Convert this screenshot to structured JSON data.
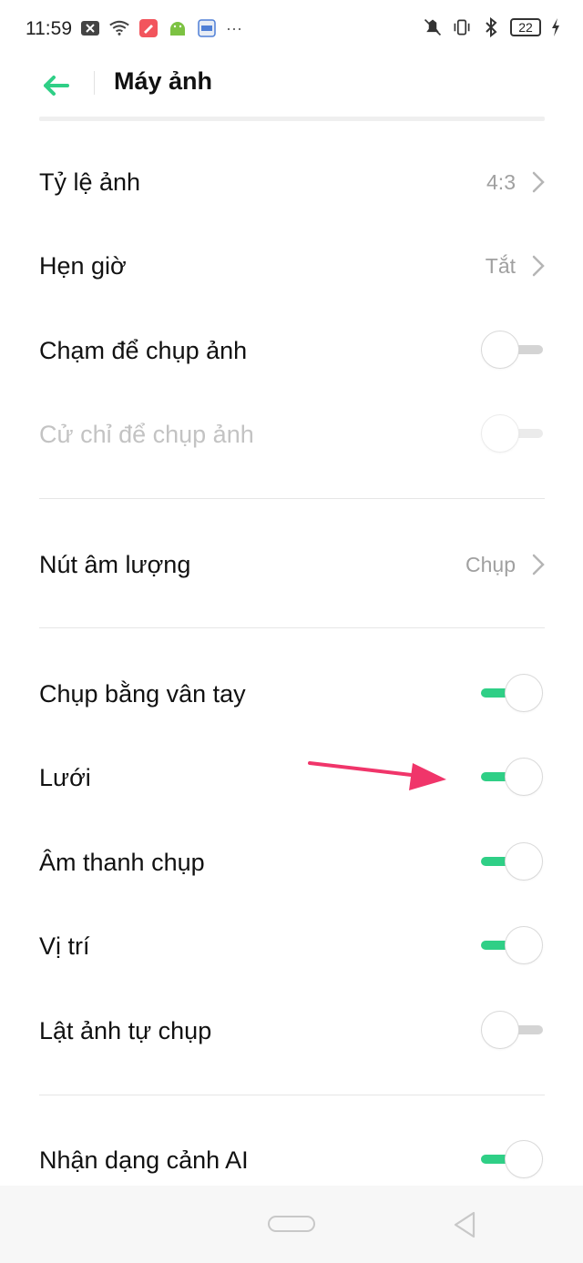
{
  "status_bar": {
    "time": "11:59",
    "more": "···",
    "battery": "22"
  },
  "header": {
    "title": "Máy ảnh"
  },
  "settings": {
    "aspect_ratio": {
      "label": "Tỷ lệ ảnh",
      "value": "4:3"
    },
    "timer": {
      "label": "Hẹn giờ",
      "value": "Tắt"
    },
    "tap_to_capture": {
      "label": "Chạm để chụp ảnh",
      "enabled": false
    },
    "gesture_capture": {
      "label": "Cử chỉ để chụp ảnh",
      "enabled": false,
      "disabled": true
    },
    "volume_button": {
      "label": "Nút âm lượng",
      "value": "Chụp"
    },
    "fingerprint_capture": {
      "label": "Chụp bằng vân tay",
      "enabled": true
    },
    "grid": {
      "label": "Lưới",
      "enabled": true
    },
    "shutter_sound": {
      "label": "Âm thanh chụp",
      "enabled": true
    },
    "location": {
      "label": "Vị trí",
      "enabled": true
    },
    "mirror_selfie": {
      "label": "Lật ảnh tự chụp",
      "enabled": false
    },
    "ai_scene": {
      "label": "Nhận dạng cảnh AI",
      "enabled": true
    }
  },
  "colors": {
    "accent": "#2fcf86",
    "annotation_arrow": "#f0356a"
  }
}
